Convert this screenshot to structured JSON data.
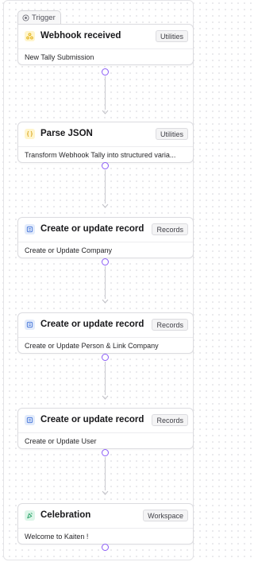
{
  "trigger": {
    "label": "Trigger",
    "icon": "target-icon"
  },
  "nodes": [
    {
      "title": "Webhook received",
      "badge": "Utilities",
      "description": "New Tally Submission",
      "icon": "webhook-icon",
      "icon_color": "#e5b520",
      "icon_bg": "#fff5cc"
    },
    {
      "title": "Parse JSON",
      "badge": "Utilities",
      "description": "Transform Webhook Tally into structured varia...",
      "icon": "braces-icon",
      "icon_color": "#d9a21a",
      "icon_bg": "#fff5cc"
    },
    {
      "title": "Create or update record",
      "badge": "Records",
      "description": "Create or Update Company",
      "icon": "database-icon",
      "icon_color": "#4f7ddb",
      "icon_bg": "#e2ebfb"
    },
    {
      "title": "Create or update record",
      "badge": "Records",
      "description": "Create or Update Person & Link Company",
      "icon": "database-icon",
      "icon_color": "#4f7ddb",
      "icon_bg": "#e2ebfb"
    },
    {
      "title": "Create or update record",
      "badge": "Records",
      "description": "Create or Update User",
      "icon": "database-icon",
      "icon_color": "#4f7ddb",
      "icon_bg": "#e2ebfb"
    },
    {
      "title": "Celebration",
      "badge": "Workspace",
      "description": "Welcome to Kaiten !",
      "icon": "party-icon",
      "icon_color": "#2fa36b",
      "icon_bg": "#dcf5e8"
    }
  ]
}
